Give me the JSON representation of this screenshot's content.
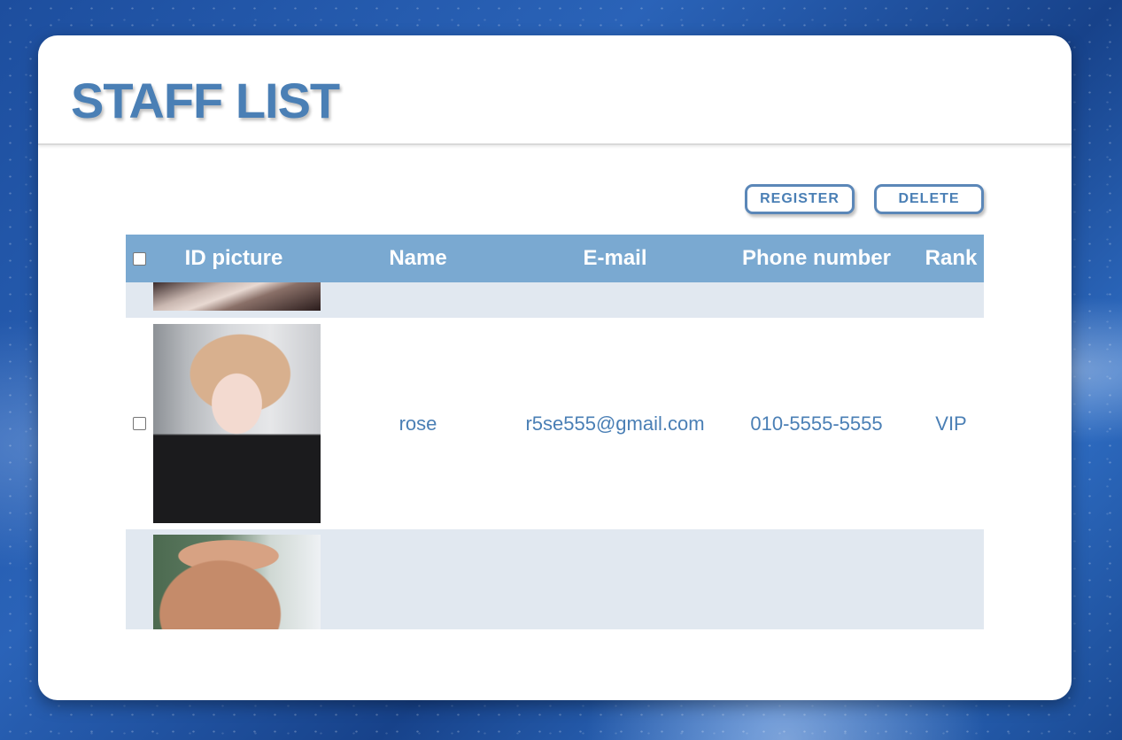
{
  "page": {
    "title": "STAFF LIST"
  },
  "toolbar": {
    "register_label": "REGISTER",
    "delete_label": "DELETE"
  },
  "table": {
    "headers": {
      "id_picture": "ID picture",
      "name": "Name",
      "email": "E-mail",
      "phone": "Phone number",
      "rank": "Rank"
    },
    "rows": [
      {
        "name": "",
        "email": "",
        "phone": "",
        "rank": ""
      },
      {
        "name": "rose",
        "email": "r5se555@gmail.com",
        "phone": "010-5555-5555",
        "rank": "VIP"
      },
      {
        "name": "",
        "email": "",
        "phone": "",
        "rank": ""
      }
    ]
  },
  "colors": {
    "accent": "#4a7fb5",
    "header_bg": "#7aa9d1",
    "row_alt_bg": "#e1e8f0"
  }
}
